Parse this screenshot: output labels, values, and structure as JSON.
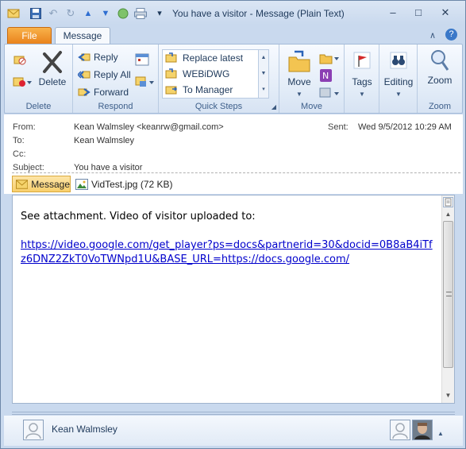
{
  "window": {
    "title": "You have a visitor  -  Message (Plain Text)",
    "min_label": "–",
    "max_label": "□",
    "close_label": "✕"
  },
  "quick_access": {
    "undo_label": "↶",
    "redo_label": "↻",
    "up_label": "▲",
    "down_label": "▼",
    "more_label": "▾"
  },
  "tabs": {
    "file": "File",
    "message": "Message",
    "collapse": "∧",
    "help": "?"
  },
  "ribbon": {
    "delete_group": {
      "label": "Delete",
      "delete_button": "Delete"
    },
    "respond_group": {
      "label": "Respond",
      "reply": "Reply",
      "reply_all": "Reply All",
      "forward": "Forward"
    },
    "quick_steps_group": {
      "label": "Quick Steps",
      "items": [
        "Replace latest",
        "WEBiDWG",
        "To Manager"
      ]
    },
    "move_group": {
      "label": "Move",
      "move_button": "Move"
    },
    "tags_group": {
      "tags_button": "Tags"
    },
    "editing_group": {
      "editing_button": "Editing"
    },
    "zoom_group": {
      "label": "Zoom",
      "zoom_button": "Zoom"
    }
  },
  "header": {
    "from_label": "From:",
    "from_value": "Kean Walmsley <keanrw@gmail.com>",
    "to_label": "To:",
    "to_value": "Kean Walmsley",
    "cc_label": "Cc:",
    "cc_value": "",
    "subject_label": "Subject:",
    "subject_value": "You have a visitor",
    "sent_label": "Sent:",
    "sent_value": "Wed 9/5/2012 10:29 AM",
    "message_tab": "Message",
    "attachment": "VidTest.jpg (72 KB)"
  },
  "body": {
    "line1": "See attachment. Video of visitor uploaded to:",
    "link": "https://video.google.com/get_player?ps=docs&partnerid=30&docid=0B8aB4iTfz6DNZ2ZkT0VoTWNpd1U&BASE_URL=https://docs.google.com/"
  },
  "people_pane": {
    "name": "Kean Walmsley"
  },
  "colors": {
    "accent_file_tab": "#e8801a",
    "link": "#0000cc",
    "ribbon_text": "#1e395b"
  }
}
